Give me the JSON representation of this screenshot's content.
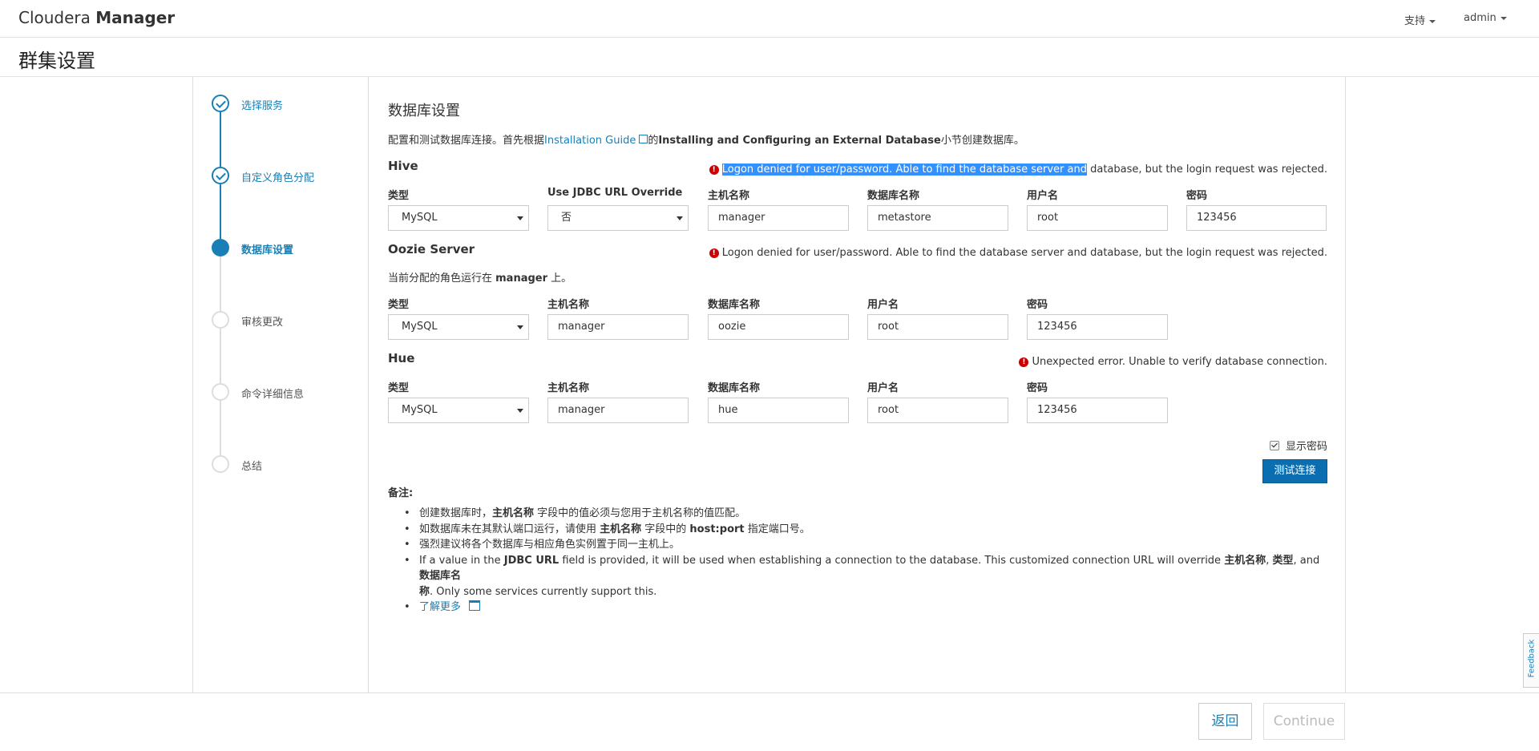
{
  "app": {
    "brand_light": "Cloudera",
    "brand_bold": "Manager"
  },
  "topnav": {
    "support": "支持",
    "user": "admin"
  },
  "page_title": "群集设置",
  "steps": [
    {
      "label": "选择服务",
      "state": "done"
    },
    {
      "label": "自定义角色分配",
      "state": "done"
    },
    {
      "label": "数据库设置",
      "state": "active"
    },
    {
      "label": "审核更改",
      "state": "todo"
    },
    {
      "label": "命令详细信息",
      "state": "todo"
    },
    {
      "label": "总结",
      "state": "todo"
    }
  ],
  "main": {
    "heading": "数据库设置",
    "intro_prefix": "配置和测试数据库连接。首先根据",
    "intro_link": "Installation Guide",
    "intro_mid": "的",
    "intro_bold": "Installing and Configuring an External Database",
    "intro_suffix": "小节创建数据库。"
  },
  "hive": {
    "title": "Hive",
    "error_selected": "Logon denied for user/password. Able to find the database server and",
    "error_rest": " database, but the login request was rejected.",
    "labels": {
      "type": "类型",
      "jdbc": "Use JDBC URL Override",
      "host": "主机名称",
      "db": "数据库名称",
      "user": "用户名",
      "password": "密码"
    },
    "values": {
      "type": "MySQL",
      "jdbc": "否",
      "host": "manager",
      "db": "metastore",
      "user": "root",
      "password": "123456"
    }
  },
  "oozie": {
    "title": "Oozie Server",
    "error": "Logon denied for user/password. Able to find the database server and database, but the login request was rejected.",
    "note_prefix": "当前分配的角色运行在 ",
    "note_host": "manager",
    "note_suffix": " 上。",
    "labels": {
      "type": "类型",
      "host": "主机名称",
      "db": "数据库名称",
      "user": "用户名",
      "password": "密码"
    },
    "values": {
      "type": "MySQL",
      "host": "manager",
      "db": "oozie",
      "user": "root",
      "password": "123456"
    }
  },
  "hue": {
    "title": "Hue",
    "error": "Unexpected error. Unable to verify database connection.",
    "labels": {
      "type": "类型",
      "host": "主机名称",
      "db": "数据库名称",
      "user": "用户名",
      "password": "密码"
    },
    "values": {
      "type": "MySQL",
      "host": "manager",
      "db": "hue",
      "user": "root",
      "password": "123456"
    }
  },
  "show_password_label": "显示密码",
  "test_button": "测试连接",
  "notes": {
    "title": "备注",
    "n1_a": "创建数据库时，",
    "n1_b": "主机名称",
    "n1_c": " 字段中的值必须与您用于主机名称的值匹配。",
    "n2_a": "如数据库未在其默认端口运行，请使用 ",
    "n2_b": "主机名称",
    "n2_c": " 字段中的 ",
    "n2_d": "host:port",
    "n2_e": " 指定端口号。",
    "n3": "强烈建议将各个数据库与相应角色实例置于同一主机上。",
    "n4_a": "If a value in the ",
    "n4_b": "JDBC URL",
    "n4_c": " field is provided, it will be used when establishing a connection to the database. This customized connection URL will override ",
    "n4_d": "主机名称",
    "n4_e": ", ",
    "n4_f": "类型",
    "n4_g": ", and ",
    "n4_h": "数据库名",
    "n4_i": "称",
    "n4_j": ". Only some services currently support this.",
    "learn_more": "了解更多"
  },
  "footer": {
    "back": "返回",
    "continue": "Continue"
  },
  "feedback": "Feedback",
  "colors": {
    "accent": "#1a7fb5",
    "button": "#0a6eb0",
    "error": "#cc0000",
    "selection": "#3390ff"
  }
}
